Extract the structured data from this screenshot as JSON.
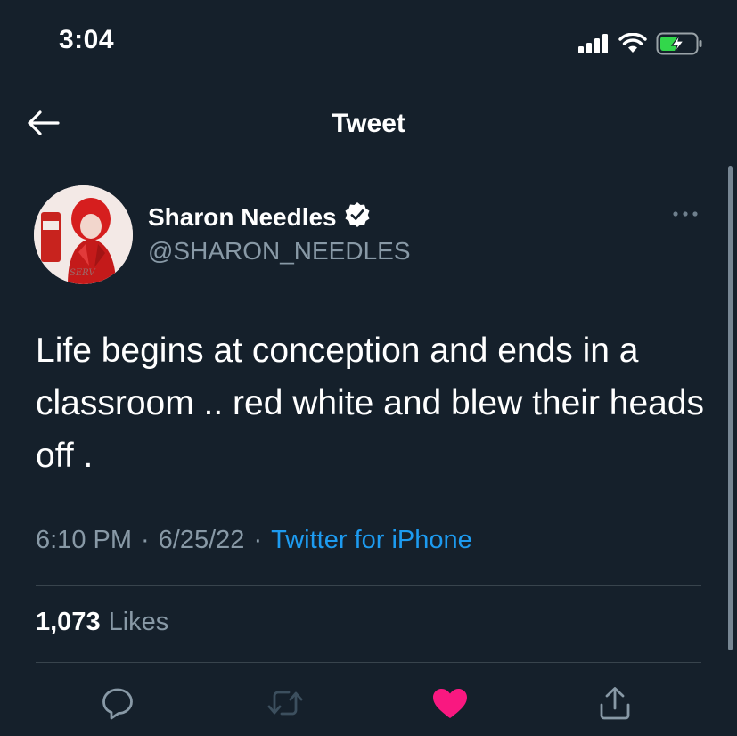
{
  "status_bar": {
    "time": "3:04",
    "icons": [
      "cellular-signal-icon",
      "wifi-icon",
      "battery-charging-icon"
    ]
  },
  "header": {
    "back_icon": "back-arrow-icon",
    "title": "Tweet"
  },
  "tweet": {
    "author": {
      "display_name": "Sharon Needles",
      "handle": "@SHARON_NEEDLES",
      "verified": true,
      "avatar_caption": "SERV"
    },
    "text": "Life begins at conception and ends in a classroom .. red white and blew their heads off .",
    "meta": {
      "time": "6:10 PM",
      "separator": "·",
      "date": "6/25/22",
      "source": "Twitter for iPhone"
    },
    "likes": {
      "count": "1,073",
      "label": "Likes"
    }
  },
  "actions": [
    {
      "name": "reply",
      "icon": "reply-icon"
    },
    {
      "name": "retweet",
      "icon": "retweet-icon"
    },
    {
      "name": "like",
      "icon": "heart-filled-icon",
      "active": true
    },
    {
      "name": "share",
      "icon": "share-icon"
    }
  ],
  "colors": {
    "background": "#15202b",
    "text_primary": "#ffffff",
    "text_secondary": "#8899a6",
    "link": "#1d9bf0",
    "like_active": "#f91880",
    "divider": "#38444d"
  }
}
